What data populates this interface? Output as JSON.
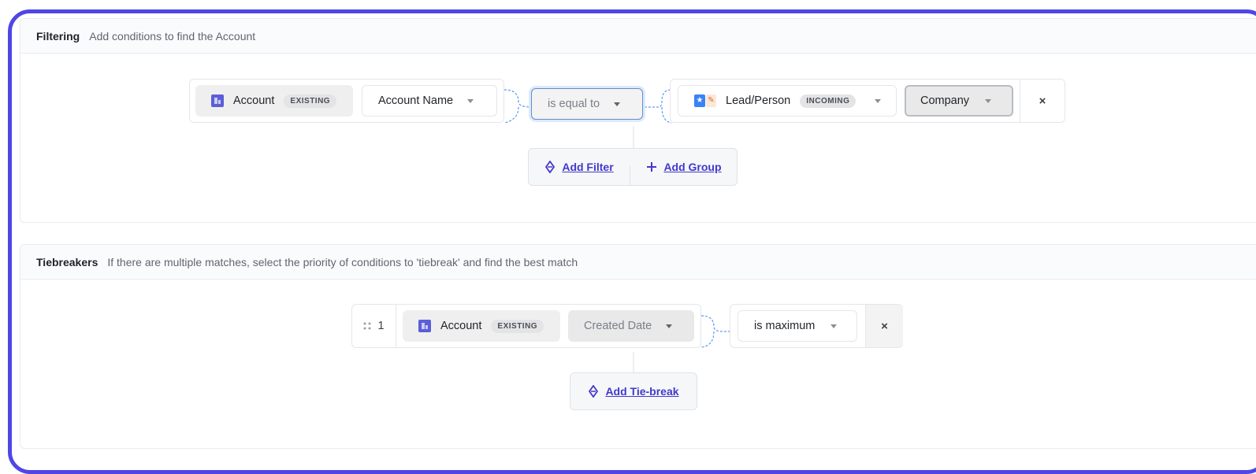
{
  "filtering": {
    "title": "Filtering",
    "description": "Add conditions to find the Account",
    "condition": {
      "left_object": "Account",
      "left_badge": "EXISTING",
      "left_field": "Account Name",
      "operator": "is equal to",
      "right_object": "Lead/Person",
      "right_badge": "INCOMING",
      "right_field": "Company",
      "remove": "×"
    },
    "add_filter": "Add Filter",
    "add_group": "Add Group"
  },
  "tiebreakers": {
    "title": "Tiebreakers",
    "description": "If there are multiple matches, select the priority of conditions to 'tiebreak' and find the best match",
    "rule": {
      "index": "1",
      "object": "Account",
      "badge": "EXISTING",
      "field": "Created Date",
      "operator": "is maximum",
      "remove": "×"
    },
    "add_tiebreak": "Add Tie-break"
  },
  "colors": {
    "frame_border": "#4f46e5",
    "accent_link": "#4338ca",
    "account_icon": "#5b5ed6"
  }
}
